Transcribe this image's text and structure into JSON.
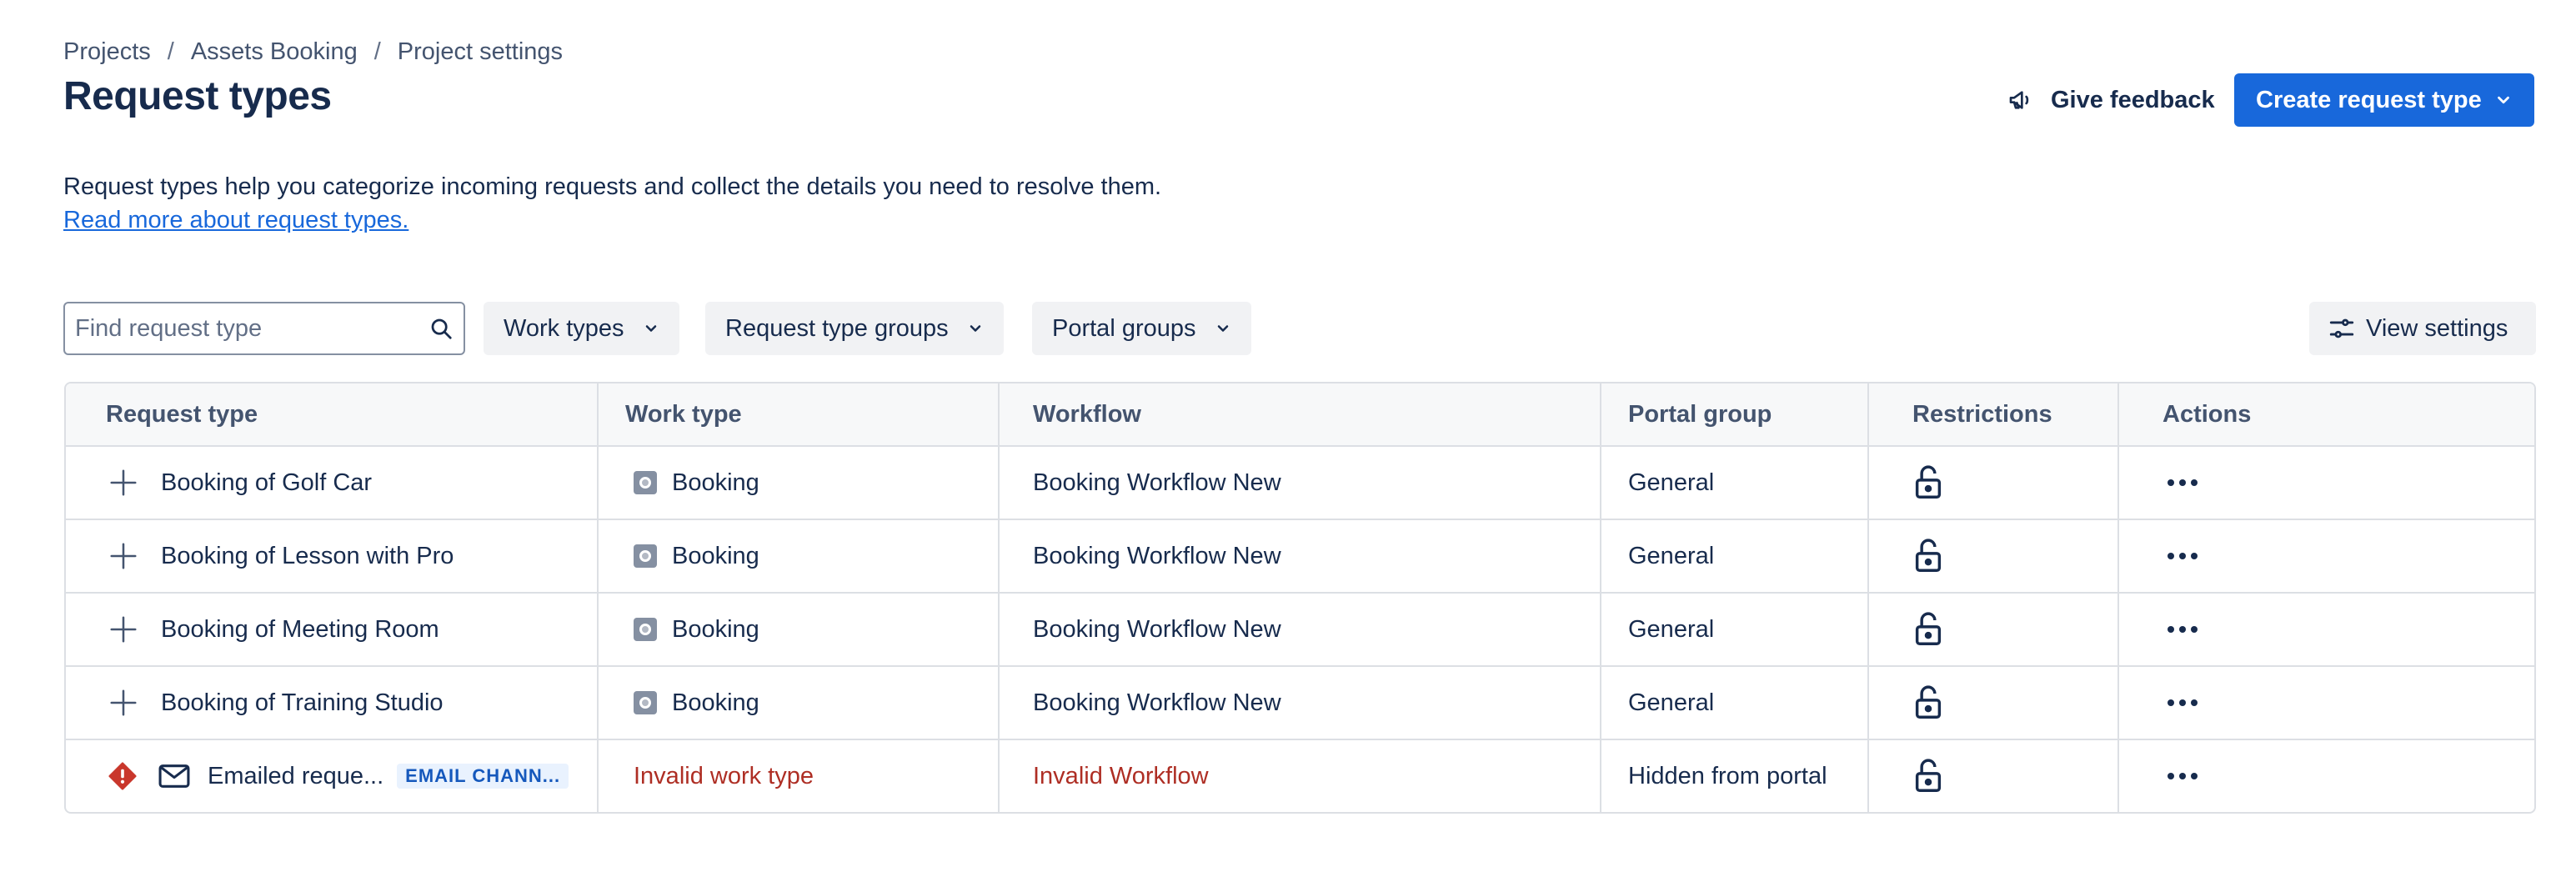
{
  "breadcrumb": {
    "items": [
      "Projects",
      "Assets Booking",
      "Project settings"
    ],
    "separator": "/"
  },
  "page_title": "Request types",
  "header": {
    "feedback_label": "Give feedback",
    "create_label": "Create request type"
  },
  "description": {
    "text": "Request types help you categorize incoming requests and collect the details you need to resolve them.",
    "link": "Read more about request types."
  },
  "filters": {
    "search_placeholder": "Find request type",
    "work_types": "Work types",
    "request_type_groups": "Request type groups",
    "portal_groups": "Portal groups",
    "view_settings": "View settings"
  },
  "table": {
    "columns": [
      "Request type",
      "Work type",
      "Workflow",
      "Portal group",
      "Restrictions",
      "Actions"
    ],
    "rows": [
      {
        "request_type": "Booking of Golf Car",
        "work_type": "Booking",
        "workflow": "Booking Workflow New",
        "portal_group": "General",
        "restriction": "unlocked"
      },
      {
        "request_type": "Booking of Lesson with Pro",
        "work_type": "Booking",
        "workflow": "Booking Workflow New",
        "portal_group": "General",
        "restriction": "unlocked"
      },
      {
        "request_type": "Booking of Meeting Room",
        "work_type": "Booking",
        "workflow": "Booking Workflow New",
        "portal_group": "General",
        "restriction": "unlocked"
      },
      {
        "request_type": "Booking of Training Studio",
        "work_type": "Booking",
        "workflow": "Booking Workflow New",
        "portal_group": "General",
        "restriction": "unlocked"
      },
      {
        "request_type": "Emailed reque...",
        "badge": "EMAIL CHANN...",
        "work_type": "Invalid work type",
        "workflow": "Invalid Workflow",
        "portal_group": "Hidden from portal",
        "restriction": "unlocked",
        "status": "error"
      }
    ]
  },
  "colors": {
    "primary": "#1868db",
    "error": "#ae2e24",
    "badge_bg": "#e9f2fe",
    "badge_text": "#1558bc"
  }
}
